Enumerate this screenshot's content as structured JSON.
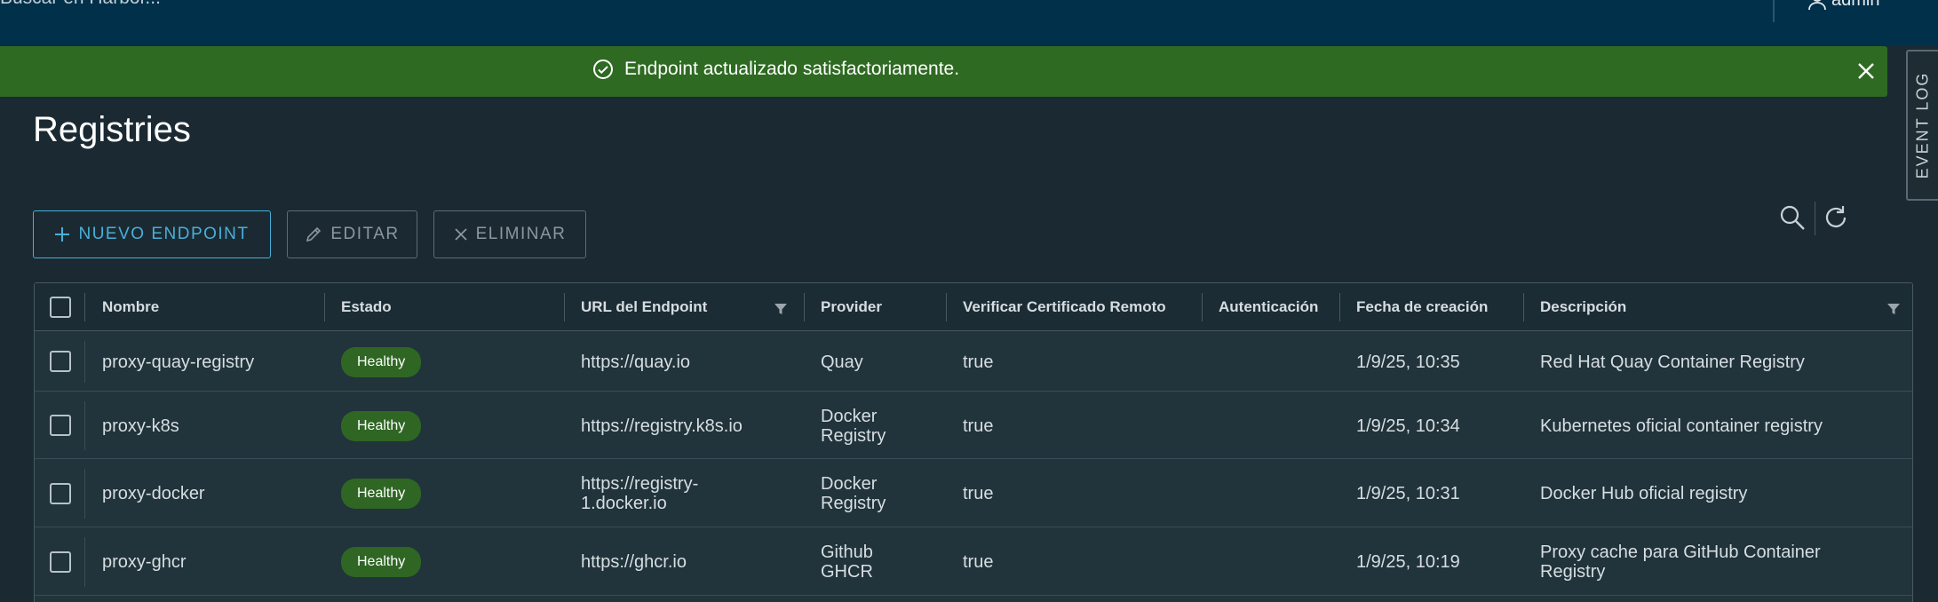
{
  "topbar": {
    "search_placeholder": "Buscar en Harbor...",
    "user": "admin"
  },
  "alert": {
    "message": "Endpoint actualizado satisfactoriamente."
  },
  "event_log": "EVENT LOG",
  "page": {
    "title": "Registries"
  },
  "toolbar": {
    "new_label": "NUEVO ENDPOINT",
    "edit_label": "EDITAR",
    "delete_label": "ELIMINAR"
  },
  "table": {
    "columns": [
      "Nombre",
      "Estado",
      "URL del Endpoint",
      "Provider",
      "Verificar Certificado Remoto",
      "Autenticación",
      "Fecha de creación",
      "Descripción"
    ],
    "rows": [
      {
        "name": "proxy-quay-registry",
        "status": "Healthy",
        "url": "https://quay.io",
        "provider": "Quay",
        "verify": "true",
        "auth": "",
        "created": "1/9/25, 10:35",
        "description": "Red Hat Quay Container Registry"
      },
      {
        "name": "proxy-k8s",
        "status": "Healthy",
        "url": "https://registry.k8s.io",
        "provider": "Docker Registry",
        "verify": "true",
        "auth": "",
        "created": "1/9/25, 10:34",
        "description": "Kubernetes oficial container registry"
      },
      {
        "name": "proxy-docker",
        "status": "Healthy",
        "url": "https://registry-1.docker.io",
        "provider": "Docker Registry",
        "verify": "true",
        "auth": "",
        "created": "1/9/25, 10:31",
        "description": "Docker Hub oficial registry"
      },
      {
        "name": "proxy-ghcr",
        "status": "Healthy",
        "url": "https://ghcr.io",
        "provider": "Github GHCR",
        "verify": "true",
        "auth": "",
        "created": "1/9/25, 10:19",
        "description": "Proxy cache para GitHub Container Registry"
      }
    ]
  },
  "colors": {
    "topbar": "#00304a",
    "alert_success": "#2e6a22",
    "accent": "#49afd9",
    "badge_healthy": "#2f6624"
  },
  "icons": [
    "search-icon",
    "refresh-icon",
    "user-icon",
    "check-circle-icon",
    "close-icon",
    "plus-icon",
    "pencil-icon",
    "x-icon",
    "filter-icon"
  ]
}
